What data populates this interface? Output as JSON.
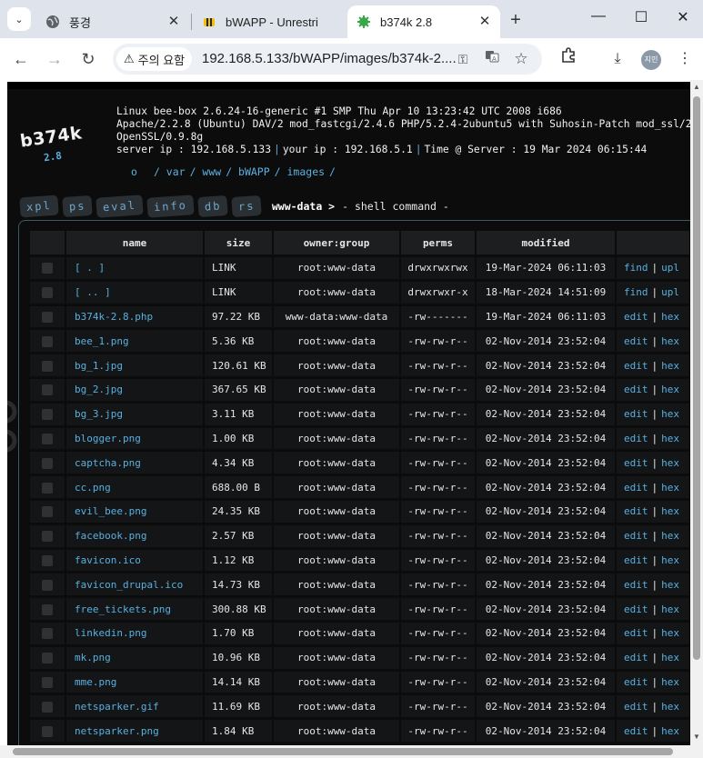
{
  "browser": {
    "tabs": [
      {
        "title": "풍경",
        "favicon": "globe-icon"
      },
      {
        "title": "bWAPP - Unrestri",
        "favicon": "bee-icon"
      },
      {
        "title": "b374k 2.8",
        "favicon": "gear-bug-icon"
      }
    ],
    "active_tab": 2,
    "security_label": "주의 요함",
    "url": "192.168.5.133/bWAPP/images/b374k-2....",
    "profile_initials": "지민"
  },
  "shell": {
    "logo": "b374k",
    "version": "2.8",
    "info_lines": [
      "Linux bee-box 2.6.24-16-generic #1 SMP Thu Apr 10 13:23:42 UTC 2008 i686",
      "Apache/2.2.8 (Ubuntu) DAV/2 mod_fastcgi/2.4.6 PHP/5.2.4-2ubuntu5 with Suhosin-Patch mod_ssl/2.2.8",
      "OpenSSL/0.9.8g"
    ],
    "server_ip": "server ip : 192.168.5.133",
    "your_ip": "your ip : 192.168.5.1",
    "time": "Time @ Server : 19 Mar 2024 06:15:44",
    "path": [
      "o",
      "/ var",
      "/ www",
      "/ bWAPP",
      "/ images",
      "/"
    ],
    "menu": [
      "xpl",
      "ps",
      "eval",
      "info",
      "db",
      "rs"
    ],
    "user": "www-data >",
    "command": "- shell command -"
  },
  "table": {
    "headers": [
      "name",
      "size",
      "owner:group",
      "perms",
      "modified"
    ],
    "rows": [
      {
        "name": "[ . ]",
        "size": "LINK",
        "owner": "root:www-data",
        "perms": "drwxrwxrwx",
        "modified": "19-Mar-2024 06:11:03",
        "a1": "find",
        "a2": "upl"
      },
      {
        "name": "[ .. ]",
        "size": "LINK",
        "owner": "root:www-data",
        "perms": "drwxrwxr-x",
        "modified": "18-Mar-2024 14:51:09",
        "a1": "find",
        "a2": "upl"
      },
      {
        "name": "b374k-2.8.php",
        "size": "97.22 KB",
        "owner": "www-data:www-data",
        "perms": "-rw-------",
        "modified": "19-Mar-2024 06:11:03",
        "a1": "edit",
        "a2": "hex"
      },
      {
        "name": "bee_1.png",
        "size": "5.36 KB",
        "owner": "root:www-data",
        "perms": "-rw-rw-r--",
        "modified": "02-Nov-2014 23:52:04",
        "a1": "edit",
        "a2": "hex"
      },
      {
        "name": "bg_1.jpg",
        "size": "120.61 KB",
        "owner": "root:www-data",
        "perms": "-rw-rw-r--",
        "modified": "02-Nov-2014 23:52:04",
        "a1": "edit",
        "a2": "hex"
      },
      {
        "name": "bg_2.jpg",
        "size": "367.65 KB",
        "owner": "root:www-data",
        "perms": "-rw-rw-r--",
        "modified": "02-Nov-2014 23:52:04",
        "a1": "edit",
        "a2": "hex"
      },
      {
        "name": "bg_3.jpg",
        "size": "3.11 KB",
        "owner": "root:www-data",
        "perms": "-rw-rw-r--",
        "modified": "02-Nov-2014 23:52:04",
        "a1": "edit",
        "a2": "hex"
      },
      {
        "name": "blogger.png",
        "size": "1.00 KB",
        "owner": "root:www-data",
        "perms": "-rw-rw-r--",
        "modified": "02-Nov-2014 23:52:04",
        "a1": "edit",
        "a2": "hex"
      },
      {
        "name": "captcha.png",
        "size": "4.34 KB",
        "owner": "root:www-data",
        "perms": "-rw-rw-r--",
        "modified": "02-Nov-2014 23:52:04",
        "a1": "edit",
        "a2": "hex"
      },
      {
        "name": "cc.png",
        "size": "688.00 B",
        "owner": "root:www-data",
        "perms": "-rw-rw-r--",
        "modified": "02-Nov-2014 23:52:04",
        "a1": "edit",
        "a2": "hex"
      },
      {
        "name": "evil_bee.png",
        "size": "24.35 KB",
        "owner": "root:www-data",
        "perms": "-rw-rw-r--",
        "modified": "02-Nov-2014 23:52:04",
        "a1": "edit",
        "a2": "hex"
      },
      {
        "name": "facebook.png",
        "size": "2.57 KB",
        "owner": "root:www-data",
        "perms": "-rw-rw-r--",
        "modified": "02-Nov-2014 23:52:04",
        "a1": "edit",
        "a2": "hex"
      },
      {
        "name": "favicon.ico",
        "size": "1.12 KB",
        "owner": "root:www-data",
        "perms": "-rw-rw-r--",
        "modified": "02-Nov-2014 23:52:04",
        "a1": "edit",
        "a2": "hex"
      },
      {
        "name": "favicon_drupal.ico",
        "size": "14.73 KB",
        "owner": "root:www-data",
        "perms": "-rw-rw-r--",
        "modified": "02-Nov-2014 23:52:04",
        "a1": "edit",
        "a2": "hex"
      },
      {
        "name": "free_tickets.png",
        "size": "300.88 KB",
        "owner": "root:www-data",
        "perms": "-rw-rw-r--",
        "modified": "02-Nov-2014 23:52:04",
        "a1": "edit",
        "a2": "hex"
      },
      {
        "name": "linkedin.png",
        "size": "1.70 KB",
        "owner": "root:www-data",
        "perms": "-rw-rw-r--",
        "modified": "02-Nov-2014 23:52:04",
        "a1": "edit",
        "a2": "hex"
      },
      {
        "name": "mk.png",
        "size": "10.96 KB",
        "owner": "root:www-data",
        "perms": "-rw-rw-r--",
        "modified": "02-Nov-2014 23:52:04",
        "a1": "edit",
        "a2": "hex"
      },
      {
        "name": "mme.png",
        "size": "14.14 KB",
        "owner": "root:www-data",
        "perms": "-rw-rw-r--",
        "modified": "02-Nov-2014 23:52:04",
        "a1": "edit",
        "a2": "hex"
      },
      {
        "name": "netsparker.gif",
        "size": "11.69 KB",
        "owner": "root:www-data",
        "perms": "-rw-rw-r--",
        "modified": "02-Nov-2014 23:52:04",
        "a1": "edit",
        "a2": "hex"
      },
      {
        "name": "netsparker.png",
        "size": "1.84 KB",
        "owner": "root:www-data",
        "perms": "-rw-rw-r--",
        "modified": "02-Nov-2014 23:52:04",
        "a1": "edit",
        "a2": "hex"
      }
    ]
  },
  "colors": {
    "link": "#5ab0e0",
    "background": "#0c0c0c",
    "cell": "#141516",
    "header": "#1c1e20"
  }
}
